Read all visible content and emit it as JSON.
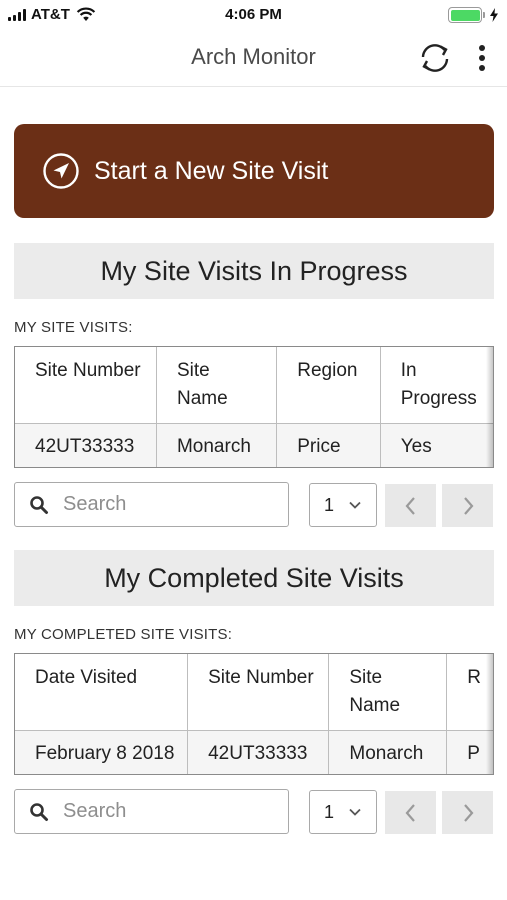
{
  "status_bar": {
    "carrier": "AT&T",
    "time": "4:06 PM",
    "battery_level": 1.0,
    "battery_color": "#4cd964"
  },
  "app": {
    "title": "Arch Monitor",
    "accent_color": "#6b2f16"
  },
  "actions": {
    "start_visit_label": "Start a New Site Visit"
  },
  "in_progress": {
    "heading": "My Site Visits In Progress",
    "caption": "MY SITE VISITS:",
    "columns": [
      "Site Number",
      "Site Name",
      "Region",
      "In Progress"
    ],
    "rows": [
      [
        "42UT33333",
        "Monarch",
        "Price",
        "Yes"
      ]
    ],
    "search_placeholder": "Search",
    "page_value": "1"
  },
  "completed": {
    "heading": "My Completed Site Visits",
    "caption": "MY COMPLETED SITE VISITS:",
    "columns": [
      "Date Visited",
      "Site Number",
      "Site Name",
      "R"
    ],
    "rows": [
      [
        "February 8 2018",
        "42UT33333",
        "Monarch",
        "P"
      ]
    ],
    "search_placeholder": "Search",
    "page_value": "1"
  },
  "icons": {
    "sync": "sync-icon",
    "more": "more-vertical-icon",
    "start": "navigation-arrow-icon",
    "search": "search-icon",
    "dropdown": "chevron-down-icon",
    "prev": "chevron-left-icon",
    "next": "chevron-right-icon"
  }
}
